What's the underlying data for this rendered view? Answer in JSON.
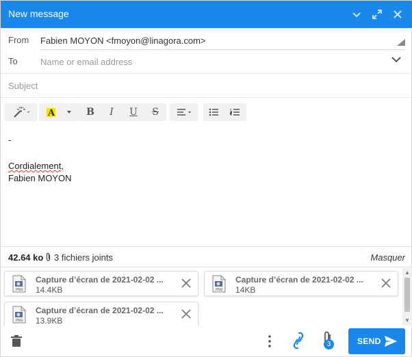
{
  "header": {
    "title": "New message"
  },
  "from": {
    "label": "From",
    "value": "Fabien MOYON <fmoyon@linagora.com>"
  },
  "to": {
    "label": "To",
    "placeholder": "Name or email address"
  },
  "subject": {
    "placeholder": "Subject"
  },
  "body": {
    "lines": [
      "-",
      "Cordialement,",
      "Fabien MOYON"
    ]
  },
  "attachments_bar": {
    "total_size": "42.64 ko",
    "count_text": "3 fichiers joints",
    "hide_label": "Masquer"
  },
  "attachments": [
    {
      "name": "Capture d’écran de 2021-02-02 ...",
      "size": "14.4KB",
      "file_icon": "png-file-icon"
    },
    {
      "name": "Capture d’écran de 2021-02-02 ...",
      "size": "14KB",
      "file_icon": "png-file-icon"
    },
    {
      "name": "Capture d’écran de 2021-02-02 ...",
      "size": "13.9KB",
      "file_icon": "png-file-icon"
    }
  ],
  "footer": {
    "send_label": "SEND",
    "attachment_badge": "3"
  },
  "colors": {
    "accent": "#1a88ea",
    "highlight": "#f5e400"
  }
}
